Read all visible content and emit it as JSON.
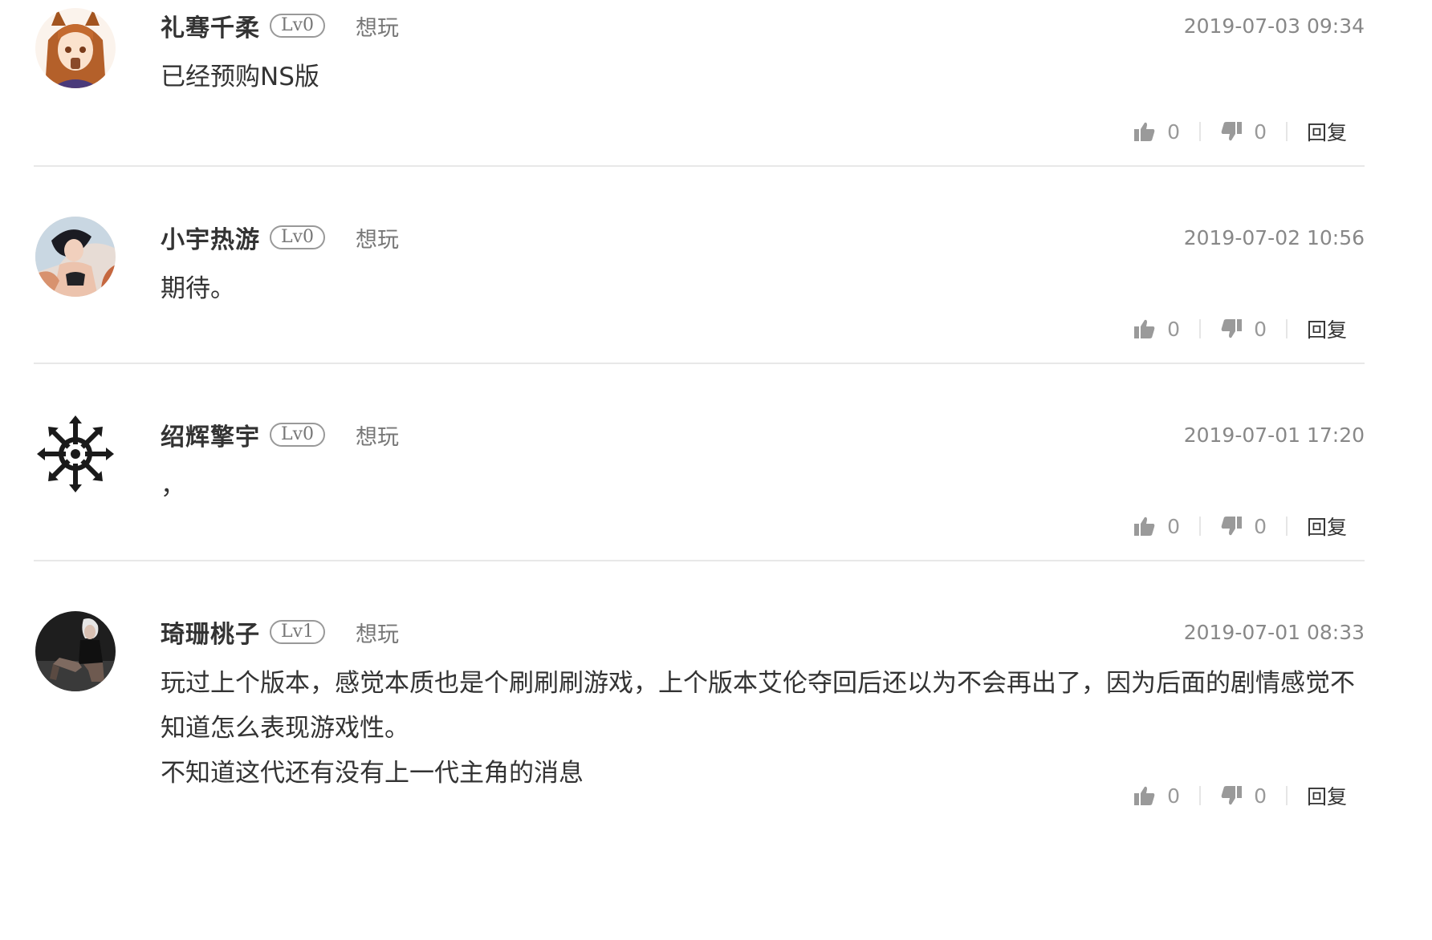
{
  "colors": {
    "text_primary": "#333333",
    "text_secondary": "#888888",
    "divider": "#e8e8e8",
    "icon": "#9a9a9a"
  },
  "comments": [
    {
      "username": "礼骞千柔",
      "level": "Lv0",
      "tag": "想玩",
      "timestamp": "2019-07-03 09:34",
      "content": [
        "已经预购NS版"
      ],
      "likes": "0",
      "dislikes": "0",
      "reply_label": "回复",
      "avatar_icon": "anime-girl-avatar"
    },
    {
      "username": "小宇热游",
      "level": "Lv0",
      "tag": "想玩",
      "timestamp": "2019-07-02 10:56",
      "content": [
        "期待。"
      ],
      "likes": "0",
      "dislikes": "0",
      "reply_label": "回复",
      "avatar_icon": "character-portrait-avatar"
    },
    {
      "username": "绍辉擎宇",
      "level": "Lv0",
      "tag": "想玩",
      "timestamp": "2019-07-01 17:20",
      "content": [
        "，"
      ],
      "likes": "0",
      "dislikes": "0",
      "reply_label": "回复",
      "avatar_icon": "chaos-star-avatar"
    },
    {
      "username": "琦珊桃子",
      "level": "Lv1",
      "tag": "想玩",
      "timestamp": "2019-07-01 08:33",
      "content": [
        "玩过上个版本，感觉本质也是个刷刷刷游戏，上个版本艾伦夺回后还以为不会再出了，因为后面的剧情感觉不知道怎么表现游戏性。",
        "不知道这代还有没有上一代主角的消息"
      ],
      "likes": "0",
      "dislikes": "0",
      "reply_label": "回复",
      "avatar_icon": "dark-figure-avatar"
    }
  ]
}
